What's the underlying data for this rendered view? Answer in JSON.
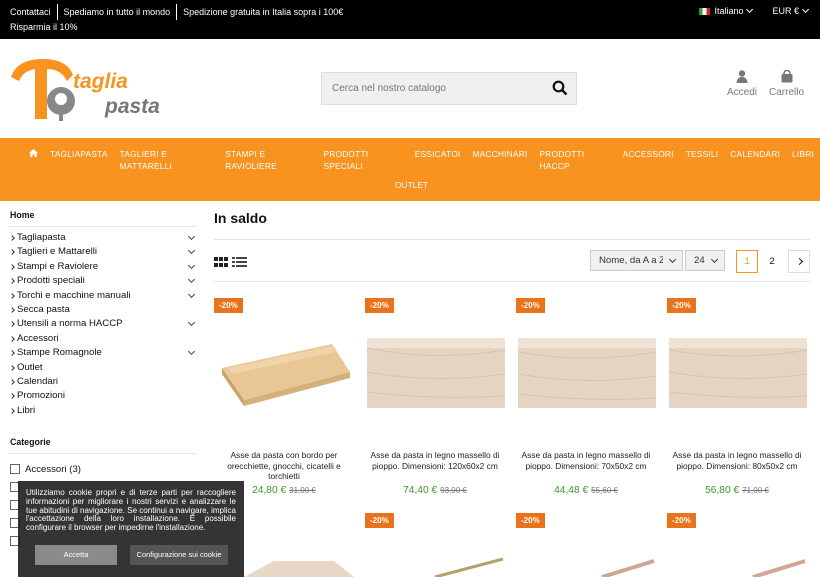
{
  "topbar": {
    "links": [
      "Contattaci",
      "Spediamo in tutto il mondo",
      "Spedizione gratuita in Italia sopra i 100€"
    ],
    "promo": "Risparmia il 10%",
    "language": "Italiano",
    "currency": "EUR €"
  },
  "header": {
    "logo_text": "tagliapasta",
    "search_placeholder": "Cerca nel nostro catalogo",
    "account_label": "Accedi",
    "cart_label": "Carrello"
  },
  "nav": {
    "items": [
      "TAGLIAPASTA",
      "TAGLIERI E MATTARELLI",
      "STAMPI E RAVIOLIERE",
      "PRODOTTI SPECIALI",
      "ESSICATOI",
      "MACCHINARI",
      "PRODOTTI HACCP",
      "ACCESSORI",
      "TESSILI",
      "CALENDARI",
      "LIBRI"
    ],
    "outlet": "OUTLET"
  },
  "sidebar": {
    "home": "Home",
    "items": [
      {
        "label": "Tagliapasta",
        "expand": true
      },
      {
        "label": "Taglieri e Mattarelli",
        "expand": true
      },
      {
        "label": "Stampi e Raviolere",
        "expand": true
      },
      {
        "label": "Prodotti speciali",
        "expand": true
      },
      {
        "label": "Torchi e macchine manuali",
        "expand": true
      },
      {
        "label": "Secca pasta",
        "expand": false
      },
      {
        "label": "Utensili a norma HACCP",
        "expand": true
      },
      {
        "label": "Accessori",
        "expand": false
      },
      {
        "label": "Stampe Romagnole",
        "expand": true
      },
      {
        "label": "Outlet",
        "expand": false
      },
      {
        "label": "Calendari",
        "expand": false
      },
      {
        "label": "Promozioni",
        "expand": false
      },
      {
        "label": "Libri",
        "expand": false
      }
    ],
    "categories_title": "Categorie",
    "category_filter": "Accessori (3)"
  },
  "main": {
    "title": "In saldo",
    "sort_value": "Nome, da A a Z",
    "per_page": "24",
    "pages": [
      "1",
      "2"
    ],
    "products": [
      {
        "badge": "-20%",
        "name": "Asse da pasta con bordo per orecchiette, gnocchi, cicatelli e torchietti",
        "price": "24,80 €",
        "old_price": "31,00 €"
      },
      {
        "badge": "-20%",
        "name": "Asse da pasta in legno massello di pioppo. Dimensioni: 120x60x2 cm",
        "price": "74,40 €",
        "old_price": "93,00 €"
      },
      {
        "badge": "-20%",
        "name": "Asse da pasta in legno massello di pioppo. Dimensioni: 70x50x2 cm",
        "price": "44,48 €",
        "old_price": "55,60 €"
      },
      {
        "badge": "-20%",
        "name": "Asse da pasta in legno massello di pioppo. Dimensioni: 80x50x2 cm",
        "price": "56,80 €",
        "old_price": "71,00 €"
      }
    ],
    "row2_badges": [
      "-20%",
      "-20%",
      "-20%"
    ]
  },
  "cookie": {
    "text": "Utilizziamo cookie propri e di terze parti per raccogliere informazioni per migliorare i nostri servizi e analizzare le tue abitudini di navigazione. Se continui a navigare, implica l'accettazione della loro installazione. È possibile configurare il browser per impedirne l'installazione.",
    "accept": "Accetta",
    "configure": "Configurazione sui cookie"
  },
  "colors": {
    "accent": "#f7931e",
    "badge": "#e8731a",
    "price": "#3a9a2a"
  }
}
